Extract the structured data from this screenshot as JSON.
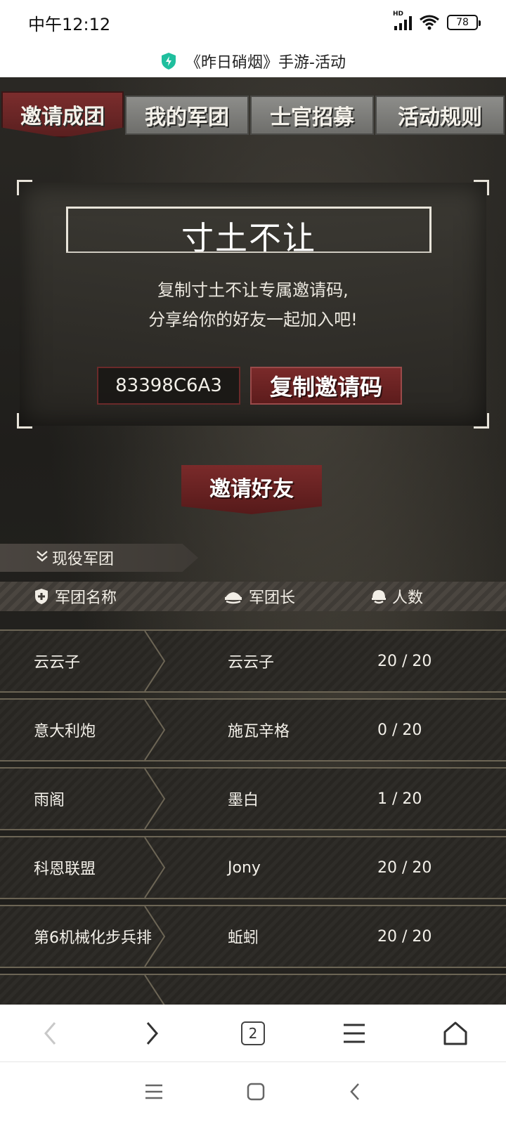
{
  "status_bar": {
    "time": "中午12:12",
    "network": "HD",
    "battery": "78"
  },
  "page": {
    "title": "《昨日硝烟》手游-活动"
  },
  "tabs": [
    {
      "label": "邀请成团",
      "active": true
    },
    {
      "label": "我的军团",
      "active": false
    },
    {
      "label": "士官招募",
      "active": false
    },
    {
      "label": "活动规则",
      "active": false
    }
  ],
  "invite_panel": {
    "title": "寸土不让",
    "desc_line1": "复制寸土不让专属邀请码,",
    "desc_line2": "分享给你的好友一起加入吧!",
    "code": "83398C6A3",
    "copy_label": "复制邀请码"
  },
  "invite_button": "邀请好友",
  "section": {
    "label": "现役军团"
  },
  "table": {
    "headers": [
      "军团名称",
      "军团长",
      "人数"
    ],
    "rows": [
      {
        "name": "云云子",
        "leader": "云云子",
        "count": "20 / 20"
      },
      {
        "name": "意大利炮",
        "leader": "施瓦辛格",
        "count": "0 / 20"
      },
      {
        "name": "雨阁",
        "leader": "墨白",
        "count": "1 / 20"
      },
      {
        "name": "科恩联盟",
        "leader": "Jony",
        "count": "20 / 20"
      },
      {
        "name": "第6机械化步兵排",
        "leader": "蚯蚓",
        "count": "20 / 20"
      }
    ]
  },
  "browser": {
    "tab_count": "2"
  },
  "colors": {
    "accent_red": "#6b2424",
    "tab_gray": "#7d7d7a",
    "background_dark": "#24231f"
  }
}
